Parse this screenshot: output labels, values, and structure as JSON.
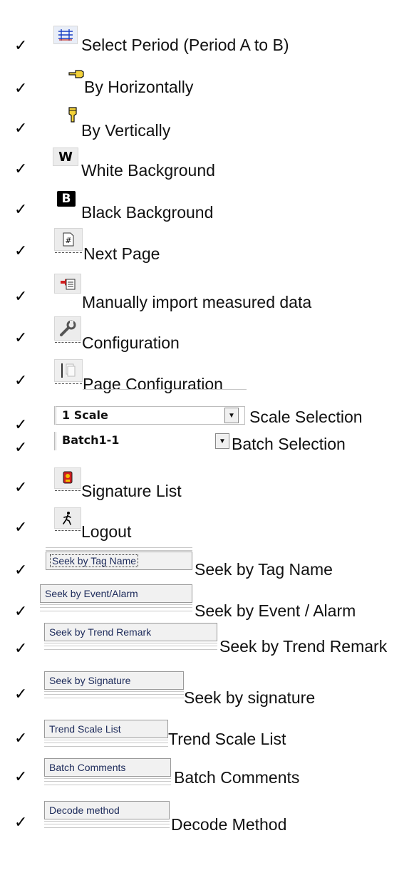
{
  "check_mark": "✓",
  "items": [
    {
      "label": "Select Period (Period A to B)",
      "icon": "grid-icon"
    },
    {
      "label": "By Horizontally",
      "icon": "hand-pointing-left-icon"
    },
    {
      "label": "By Vertically",
      "icon": "hand-pointing-down-icon"
    },
    {
      "label": "White Background",
      "icon": "w-letter-icon",
      "glyph": "W"
    },
    {
      "label": "Black Background",
      "icon": "b-letter-icon",
      "glyph": "B"
    },
    {
      "label": "Next Page",
      "icon": "page-hash-icon",
      "glyph": "#"
    },
    {
      "label": "Manually import measured data",
      "icon": "import-data-icon"
    },
    {
      "label": "Configuration",
      "icon": "wrench-icon"
    },
    {
      "label": "Page Configuration",
      "icon": "pages-icon"
    },
    {
      "label": "Scale Selection",
      "combo_value": "1 Scale"
    },
    {
      "label": "Batch Selection",
      "combo_value": "Batch1-1"
    },
    {
      "label": "Signature List",
      "icon": "signature-badge-icon"
    },
    {
      "label": "Logout",
      "icon": "running-man-icon"
    },
    {
      "label": "Seek by Tag Name",
      "button": "Seek by Tag Name"
    },
    {
      "label": "Seek by Event / Alarm",
      "button": "Seek by Event/Alarm"
    },
    {
      "label": "Seek by Trend Remark",
      "button": "Seek by Trend Remark"
    },
    {
      "label": "Seek by signature",
      "button": "Seek by Signature"
    },
    {
      "label": "Trend Scale List",
      "button": "Trend Scale List"
    },
    {
      "label": "Batch Comments",
      "button": "Batch Comments"
    },
    {
      "label": "Decode Method",
      "button": "Decode method"
    }
  ],
  "colors": {
    "accent_blue": "#1a3fc4",
    "badge_red": "#d21f1f",
    "badge_yellow": "#f3c000",
    "button_text": "#1c2a5a"
  }
}
